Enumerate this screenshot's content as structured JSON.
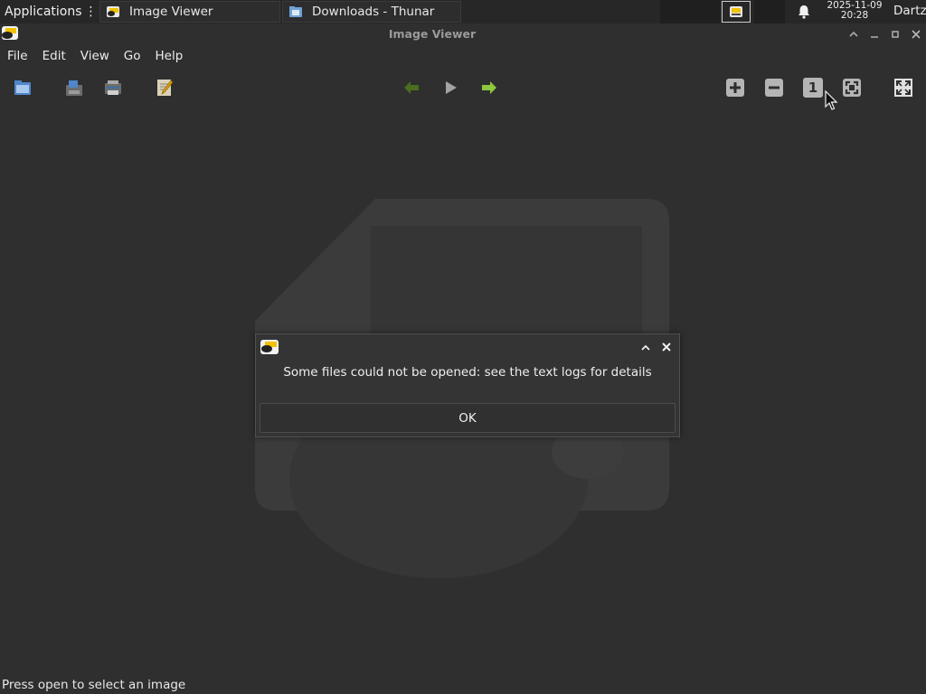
{
  "panel": {
    "apps_label": "Applications",
    "tasks": [
      {
        "label": "Image Viewer",
        "icon": "image-viewer-icon"
      },
      {
        "label": "Downloads - Thunar",
        "icon": "folder-icon"
      }
    ],
    "clock_date": "2025-11-09",
    "clock_time": "20:28",
    "user": "Dartz"
  },
  "window": {
    "title": "Image Viewer"
  },
  "menu": [
    "File",
    "Edit",
    "View",
    "Go",
    "Help"
  ],
  "toolbar": {
    "left": [
      "open-icon",
      "save-icon",
      "print-icon",
      "edit-icon"
    ],
    "center": [
      "back-icon",
      "play-icon",
      "forward-icon"
    ],
    "right": [
      "zoom-in-icon",
      "zoom-out-icon",
      "zoom-100-icon",
      "zoom-fit-icon",
      "fullscreen-icon"
    ],
    "zoom_100_label": "1"
  },
  "dialog": {
    "message": "Some files could not be opened: see the text logs for details",
    "ok_label": "OK"
  },
  "statusbar": {
    "text": "Press open to select an image"
  },
  "colors": {
    "background": "#2f2f2f",
    "panel": "#272727",
    "accent_green": "#8dc63f",
    "text": "#e6e6e6"
  }
}
